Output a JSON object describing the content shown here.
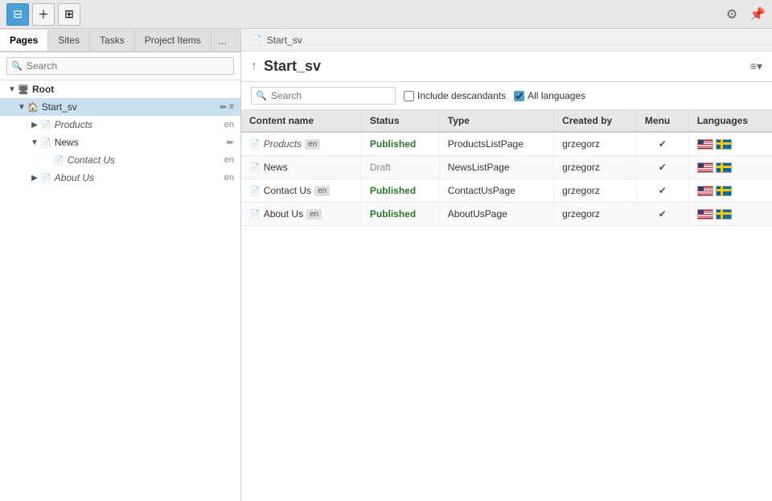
{
  "toolbar": {
    "icons": [
      {
        "id": "tree-icon",
        "symbol": "⊟",
        "active": true
      },
      {
        "id": "add-icon",
        "symbol": "＋",
        "active": false
      },
      {
        "id": "structure-icon",
        "symbol": "⊞",
        "active": false
      }
    ],
    "gear_symbol": "⚙",
    "pin_symbol": "📌"
  },
  "tabs": [
    {
      "id": "pages",
      "label": "Pages",
      "active": true
    },
    {
      "id": "sites",
      "label": "Sites",
      "active": false
    },
    {
      "id": "tasks",
      "label": "Tasks",
      "active": false
    },
    {
      "id": "project-items",
      "label": "Project Items",
      "active": false
    }
  ],
  "tab_more": "...",
  "sidebar": {
    "search_placeholder": "Search",
    "tree": {
      "root_label": "Root",
      "items": [
        {
          "id": "start_sv",
          "label": "Start_sv",
          "level": 1,
          "expanded": true,
          "selected": true,
          "has_children": true,
          "children": [
            {
              "id": "products",
              "label": "Products",
              "level": 2,
              "lang": "en",
              "italic": true,
              "has_children": true
            },
            {
              "id": "news",
              "label": "News",
              "level": 2,
              "lang": "",
              "italic": false,
              "has_children": true,
              "expanded": true,
              "children": [
                {
                  "id": "contact-us",
                  "label": "Contact Us",
                  "level": 3,
                  "lang": "en",
                  "italic": true
                }
              ]
            },
            {
              "id": "about-us",
              "label": "About Us",
              "level": 2,
              "lang": "en",
              "italic": true,
              "has_children": true
            }
          ]
        }
      ]
    }
  },
  "content": {
    "breadcrumb": "Start_sv",
    "breadcrumb_icon": "↑",
    "title": "Start_sv",
    "sort_label": "≡▾",
    "filter": {
      "search_placeholder": "Search",
      "include_descendants_label": "Include descandants",
      "all_languages_label": "All languages",
      "include_checked": false,
      "all_languages_checked": true
    },
    "table": {
      "columns": [
        "Content name",
        "Status",
        "Type",
        "Created by",
        "Menu",
        "Languages"
      ],
      "rows": [
        {
          "name": "Products",
          "lang_badge": "en",
          "italic": true,
          "status": "Published",
          "status_class": "published",
          "type": "ProductsListPage",
          "created_by": "grzegorz",
          "menu_check": true,
          "flags": [
            "us",
            "se"
          ]
        },
        {
          "name": "News",
          "lang_badge": "",
          "italic": false,
          "status": "Draft",
          "status_class": "draft",
          "type": "NewsListPage",
          "created_by": "grzegorz",
          "menu_check": true,
          "flags": [
            "us",
            "se"
          ]
        },
        {
          "name": "Contact Us",
          "lang_badge": "en",
          "italic": false,
          "status": "Published",
          "status_class": "published",
          "type": "ContactUsPage",
          "created_by": "grzegorz",
          "menu_check": true,
          "flags": [
            "us",
            "se"
          ]
        },
        {
          "name": "About Us",
          "lang_badge": "en",
          "italic": false,
          "status": "Published",
          "status_class": "published",
          "type": "AboutUsPage",
          "created_by": "grzegorz",
          "menu_check": true,
          "flags": [
            "us",
            "se"
          ]
        }
      ]
    }
  }
}
